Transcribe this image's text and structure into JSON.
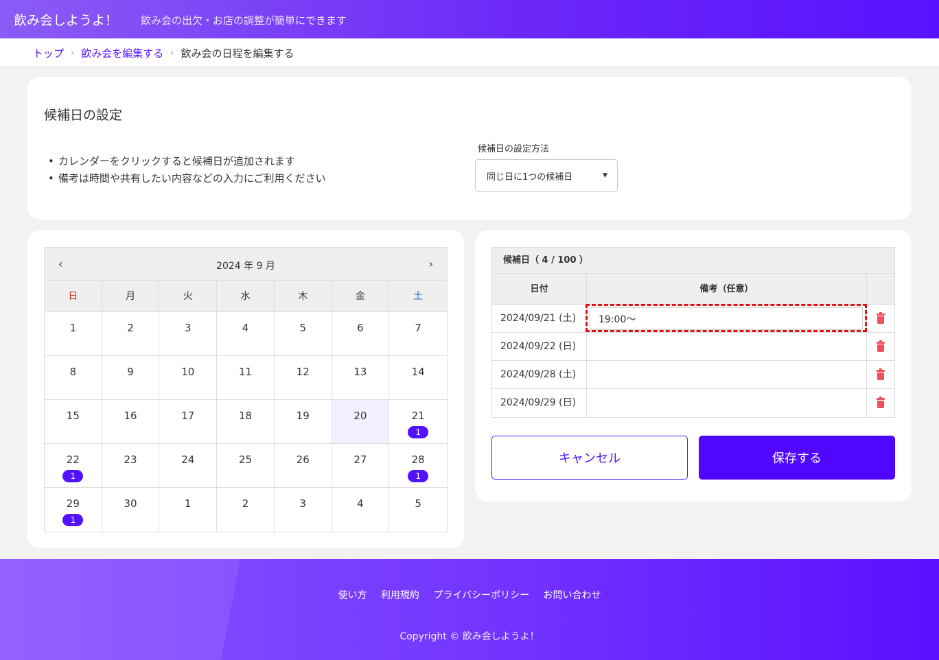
{
  "header": {
    "title": "飲み会しようよ！",
    "tagline": "飲み会の出欠・お店の調整が簡単にできます"
  },
  "breadcrumb": {
    "home": "トップ",
    "edit_party": "飲み会を編集する",
    "current": "飲み会の日程を編集する"
  },
  "settings": {
    "heading": "候補日の設定",
    "notes": [
      "カレンダーをクリックすると候補日が追加されます",
      "備考は時間や共有したい内容などの入力にご利用ください"
    ],
    "method_label": "候補日の設定方法",
    "method_value": "同じ日に1つの候補日"
  },
  "calendar": {
    "month_label": "2024 年 9 月",
    "weekdays": [
      "日",
      "月",
      "火",
      "水",
      "木",
      "金",
      "土"
    ],
    "days": [
      {
        "n": "1"
      },
      {
        "n": "2"
      },
      {
        "n": "3"
      },
      {
        "n": "4"
      },
      {
        "n": "5"
      },
      {
        "n": "6"
      },
      {
        "n": "7"
      },
      {
        "n": "8"
      },
      {
        "n": "9"
      },
      {
        "n": "10"
      },
      {
        "n": "11"
      },
      {
        "n": "12"
      },
      {
        "n": "13"
      },
      {
        "n": "14"
      },
      {
        "n": "15"
      },
      {
        "n": "16"
      },
      {
        "n": "17"
      },
      {
        "n": "18"
      },
      {
        "n": "19"
      },
      {
        "n": "20",
        "today": true
      },
      {
        "n": "21",
        "badge": "1"
      },
      {
        "n": "22",
        "badge": "1"
      },
      {
        "n": "23"
      },
      {
        "n": "24"
      },
      {
        "n": "25"
      },
      {
        "n": "26"
      },
      {
        "n": "27"
      },
      {
        "n": "28",
        "badge": "1"
      },
      {
        "n": "29",
        "badge": "1"
      },
      {
        "n": "30"
      },
      {
        "n": "1"
      },
      {
        "n": "2"
      },
      {
        "n": "3"
      },
      {
        "n": "4"
      },
      {
        "n": "5"
      }
    ]
  },
  "candidates": {
    "title": "候補日（ 4 / 100 ）",
    "col_date": "日付",
    "col_note": "備考（任意）",
    "rows": [
      {
        "date": "2024/09/21 (土)",
        "note": "19:00～"
      },
      {
        "date": "2024/09/22 (日)",
        "note": ""
      },
      {
        "date": "2024/09/28 (土)",
        "note": ""
      },
      {
        "date": "2024/09/29 (日)",
        "note": ""
      }
    ]
  },
  "actions": {
    "cancel": "キャンセル",
    "save": "保存する"
  },
  "footer": {
    "links": [
      "使い方",
      "利用規約",
      "プライバシーポリシー",
      "お問い合わせ"
    ],
    "copyright": "Copyright © 飲み会しようよ！"
  },
  "colors": {
    "brand": "#5212ff",
    "sunday": "#e0262a",
    "saturday": "#1e6bd6",
    "delete": "#f4505a"
  }
}
